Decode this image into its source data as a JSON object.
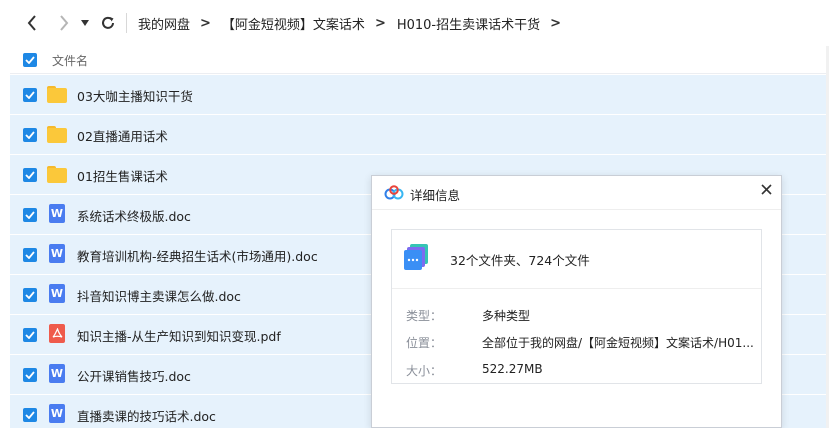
{
  "nav": {
    "breadcrumbs": [
      "我的网盘",
      "【阿金短视频】文案话术",
      "H010-招生卖课话术干货"
    ]
  },
  "list": {
    "header_label": "文件名",
    "rows": [
      {
        "name": "03大咖主播知识干货",
        "type": "folder"
      },
      {
        "name": "02直播通用话术",
        "type": "folder"
      },
      {
        "name": "01招生售课话术",
        "type": "folder"
      },
      {
        "name": "系统话术终极版.doc",
        "type": "doc"
      },
      {
        "name": "教育培训机构-经典招生话术(市场通用).doc",
        "type": "doc"
      },
      {
        "name": "抖音知识博主卖课怎么做.doc",
        "type": "doc"
      },
      {
        "name": "知识主播-从生产知识到知识变现.pdf",
        "type": "pdf"
      },
      {
        "name": "公开课销售技巧.doc",
        "type": "doc"
      },
      {
        "name": "直播卖课的技巧话术.doc",
        "type": "doc"
      }
    ]
  },
  "dialog": {
    "title": "详细信息",
    "summary": "32个文件夹、724个文件",
    "type_label": "类型：",
    "type_value": "多种类型",
    "location_label": "位置：",
    "location_value": "全部位于我的网盘/【阿金短视频】文案话术/H01...",
    "size_label": "大小：",
    "size_value": "522.27MB"
  },
  "colors": {
    "accent": "#1e88e5",
    "row_selected_bg": "#e6f2fc",
    "folder": "#fbc83a",
    "doc": "#4a7cf0",
    "pdf": "#ef5b4c"
  }
}
